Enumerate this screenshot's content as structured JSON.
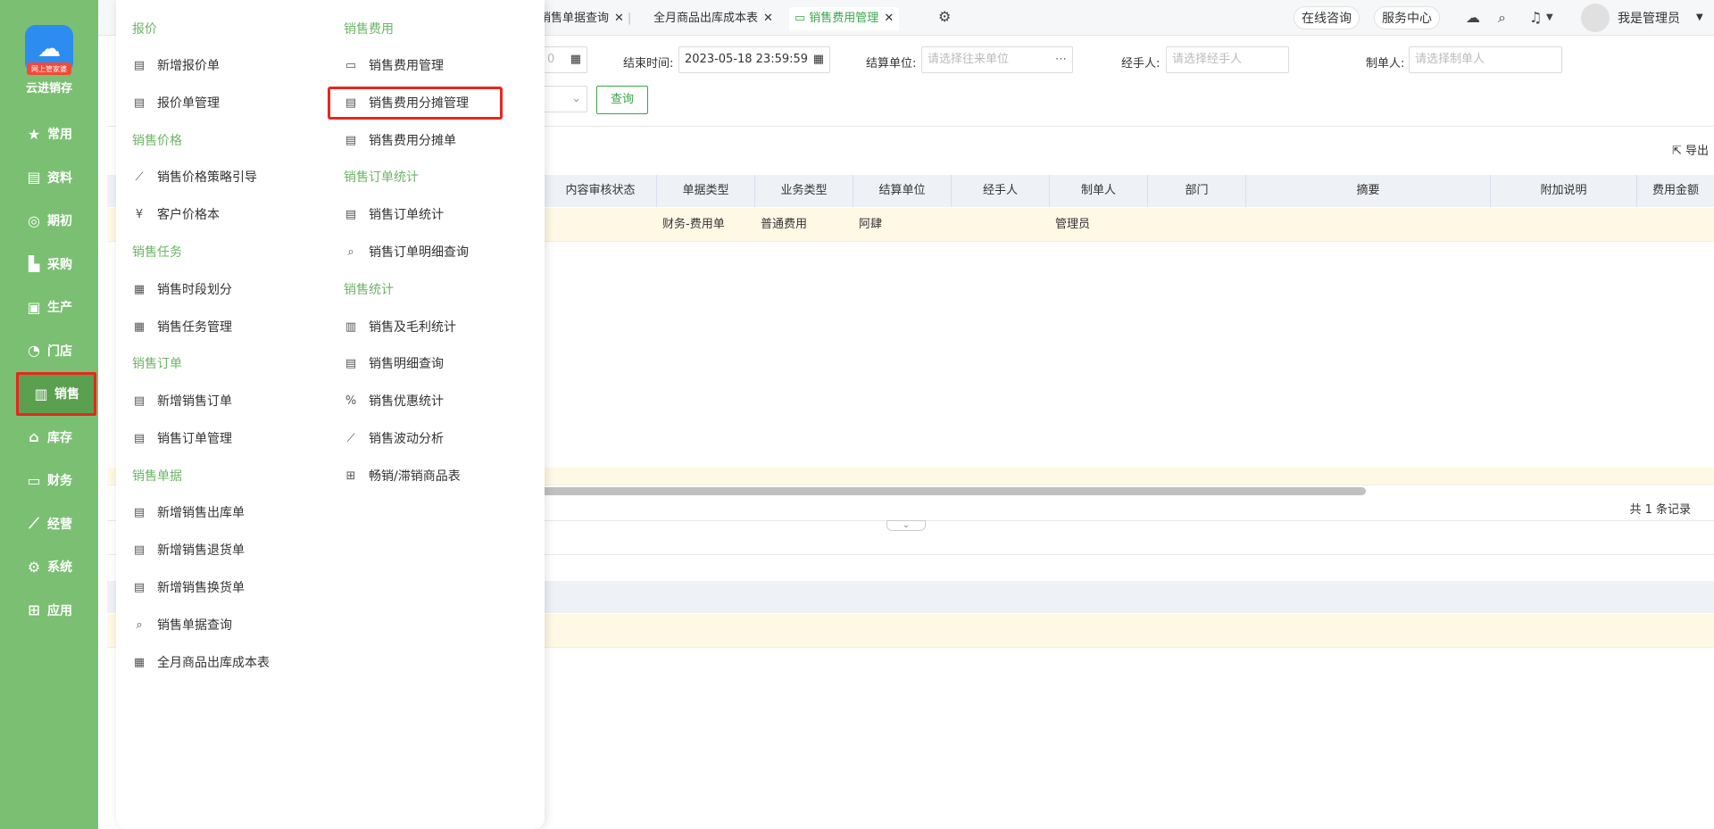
{
  "brand": {
    "name": "云进销存",
    "logo_ribbon": "网上管家婆"
  },
  "sidebar": {
    "items": [
      {
        "label": "常用",
        "icon": "star-icon"
      },
      {
        "label": "资料",
        "icon": "document-icon"
      },
      {
        "label": "期初",
        "icon": "target-icon"
      },
      {
        "label": "采购",
        "icon": "cart-icon"
      },
      {
        "label": "生产",
        "icon": "factory-icon"
      },
      {
        "label": "门店",
        "icon": "pie-icon"
      },
      {
        "label": "销售",
        "icon": "chart-icon"
      },
      {
        "label": "库存",
        "icon": "home-icon"
      },
      {
        "label": "财务",
        "icon": "wallet-icon"
      },
      {
        "label": "经营",
        "icon": "trend-icon"
      },
      {
        "label": "系统",
        "icon": "gear-icon"
      },
      {
        "label": "应用",
        "icon": "plus-icon"
      }
    ]
  },
  "tabs": [
    {
      "label": "销售单据查询"
    },
    {
      "label": "全月商品出库成本表"
    },
    {
      "label": "销售费用管理"
    }
  ],
  "topbar": {
    "consult": "在线咨询",
    "service": "服务中心",
    "user": "我是管理员"
  },
  "filter": {
    "end_time_label": "结束时间:",
    "end_time_value": "2023-05-18 23:59:59",
    "settle_label": "结算单位:",
    "settle_placeholder": "请选择往来单位",
    "handler_label": "经手人:",
    "handler_placeholder": "请选择经手人",
    "maker_label": "制单人:",
    "maker_placeholder": "请选择制单人",
    "start_time_fragment": "0",
    "query_label": "查询"
  },
  "export_label": "导出",
  "table": {
    "headers": [
      "内容审核状态",
      "单据类型",
      "业务类型",
      "结算单位",
      "经手人",
      "制单人",
      "部门",
      "摘要",
      "附加说明",
      "费用金额"
    ],
    "row": {
      "doc_type": "财务-费用单",
      "biz_type": "普通费用",
      "unit": "阿肆",
      "maker": "管理员"
    },
    "records": "共 1 条记录"
  },
  "menu": {
    "col1": [
      {
        "section": "报价",
        "items": [
          "新增报价单",
          "报价单管理"
        ]
      },
      {
        "section": "销售价格",
        "items": [
          "销售价格策略引导",
          "客户价格本"
        ]
      },
      {
        "section": "销售任务",
        "items": [
          "销售时段划分",
          "销售任务管理"
        ]
      },
      {
        "section": "销售订单",
        "items": [
          "新增销售订单",
          "销售订单管理"
        ]
      },
      {
        "section": "销售单据",
        "items": [
          "新增销售出库单",
          "新增销售退货单",
          "新增销售换货单",
          "销售单据查询",
          "全月商品出库成本表"
        ]
      }
    ],
    "col2": [
      {
        "section": "销售费用",
        "items": [
          "销售费用管理",
          "销售费用分摊管理",
          "销售费用分摊单"
        ]
      },
      {
        "section": "销售订单统计",
        "items": [
          "销售订单统计",
          "销售订单明细查询"
        ]
      },
      {
        "section": "销售统计",
        "items": [
          "销售及毛利统计",
          "销售明细查询",
          "销售优惠统计",
          "销售波动分析",
          "畅销/滞销商品表"
        ]
      }
    ]
  }
}
